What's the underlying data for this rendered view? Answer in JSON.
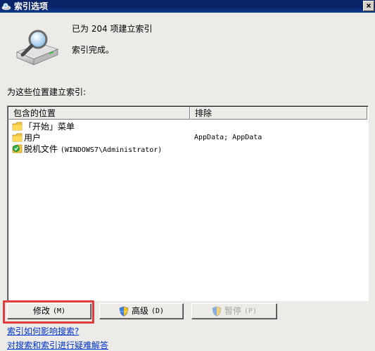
{
  "window": {
    "title": "索引选项",
    "close_label": "×"
  },
  "status": {
    "line1": "已为 204 项建立索引",
    "line2": "索引完成。"
  },
  "section_label": "为这些位置建立索引:",
  "list": {
    "columns": [
      "包含的位置",
      "排除"
    ],
    "rows": [
      {
        "icon": "folder-icon",
        "name": "「开始」菜单",
        "name_suffix": "",
        "exclude": ""
      },
      {
        "icon": "folder-icon",
        "name": "用户",
        "name_suffix": "",
        "exclude": "AppData; AppData"
      },
      {
        "icon": "offline-files-icon",
        "name": "脱机文件 ",
        "name_suffix": "(WINDOWS7\\Administrator)",
        "exclude": ""
      }
    ]
  },
  "buttons": {
    "modify": {
      "label": "修改",
      "accel": "(M)"
    },
    "advanced": {
      "label": "高级",
      "accel": "(D)"
    },
    "pause": {
      "label": "暂停",
      "accel": "(P)",
      "disabled": true
    }
  },
  "links": {
    "how_indexing_affects": "索引如何影响搜索?",
    "troubleshoot": "对搜索和索引进行疑难解答"
  },
  "colors": {
    "titlebar": "#0a246a",
    "dialog_bg": "#ecebe7",
    "link": "#0033cc",
    "highlight": "#e23b3b"
  }
}
